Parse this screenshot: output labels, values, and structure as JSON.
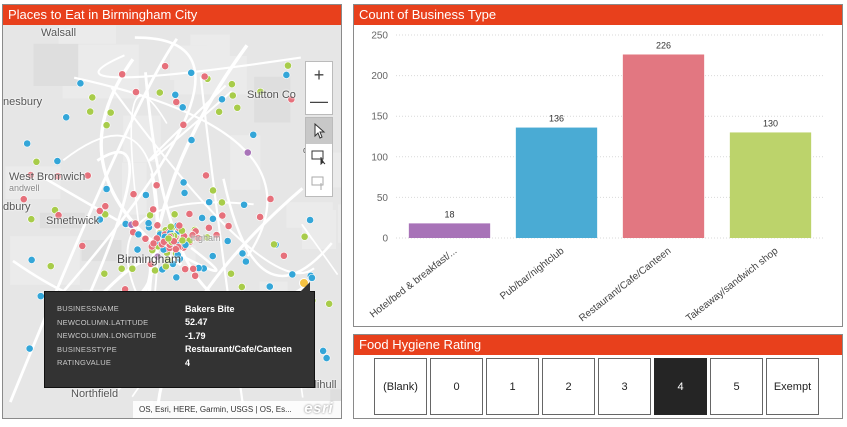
{
  "map": {
    "title": "Places to Eat in Birmingham City",
    "places": [
      "Walsall",
      "nesbury",
      "Sutton Co",
      "dfield",
      "West Bromwich",
      "andwell",
      "dbury",
      "Smethwick",
      "Birmingham",
      "Northfield",
      "Solihull",
      "ingham"
    ],
    "zoom_in": "+",
    "zoom_out": "—",
    "attribution": "OS, Esri, HERE, Garmin, USGS | OS, Es...",
    "logo": "esri",
    "legend_colors": {
      "Hotel/bed & breakfast": "#a873b8",
      "Pub/bar/nightclub": "#34a6d8",
      "Restaurant/Cafe/Canteen": "#e6707b",
      "Takeaway/sandwich shop": "#a8cc4a",
      "Highlighted": "#f5c242"
    },
    "tooltip": {
      "rows": [
        {
          "key": "BUSINESSNAME",
          "value": "Bakers Bite"
        },
        {
          "key": "NEWCOLUMN.LATITUDE",
          "value": "52.47"
        },
        {
          "key": "NEWCOLUMN.LONGITUDE",
          "value": "-1.79"
        },
        {
          "key": "BUSINESSTYPE",
          "value": "Restaurant/Cafe/Canteen"
        },
        {
          "key": "RATINGVALUE",
          "value": "4"
        }
      ]
    }
  },
  "chart": {
    "title": "Count of Business Type"
  },
  "chart_data": {
    "type": "bar",
    "title": "Count of Business Type",
    "categories": [
      "Hotel/bed & breakfast/...",
      "Pub/bar/nightclub",
      "Restaurant/Cafe/Canteen",
      "Takeaway/sandwich shop"
    ],
    "values": [
      18,
      136,
      226,
      130
    ],
    "colors": [
      "#a873b8",
      "#4aabd4",
      "#e27781",
      "#bcd36b"
    ],
    "yticks": [
      0,
      50,
      100,
      150,
      200,
      250
    ],
    "ylim": [
      0,
      250
    ],
    "xlabel": "",
    "ylabel": "",
    "grid": true
  },
  "slicer": {
    "title": "Food Hygiene Rating",
    "options": [
      "(Blank)",
      "0",
      "1",
      "2",
      "3",
      "4",
      "5",
      "Exempt"
    ],
    "selected": "4"
  }
}
